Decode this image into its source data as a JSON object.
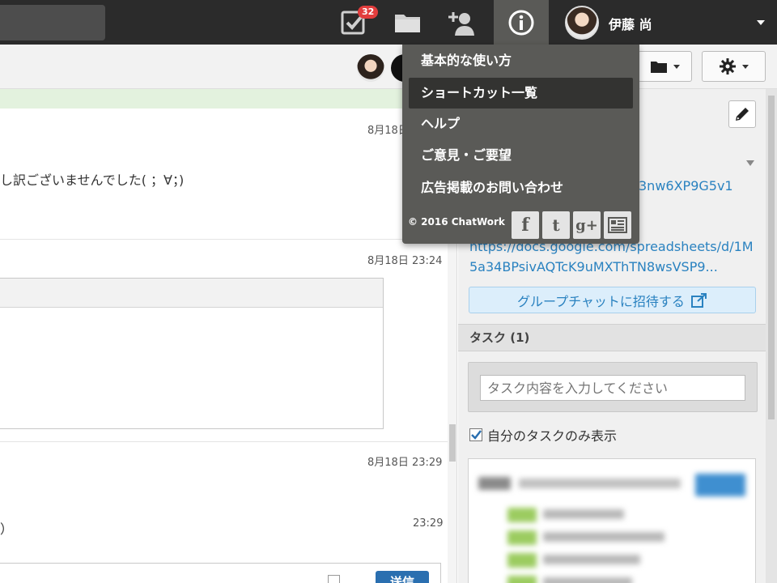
{
  "topbar": {
    "task_badge": "32",
    "user_name": "伊藤 尚"
  },
  "icons": {
    "tasks": "task-check-icon",
    "files": "folder-icon",
    "contacts": "add-contact-icon",
    "info": "info-icon",
    "settings": "gear-icon",
    "edit": "pencil-icon",
    "external": "external-link-icon"
  },
  "colors": {
    "topbar": "#2b2b2b",
    "dropdown": "#5a5a57",
    "badge": "#e23d3d",
    "link": "#2a82c0",
    "send": "#2a6fb0"
  },
  "help_menu": {
    "items": [
      {
        "label": "基本的な使い方"
      },
      {
        "label": "ショートカット一覧"
      },
      {
        "label": "ヘルプ"
      },
      {
        "label": "ご意見・ご要望"
      },
      {
        "label": "広告掲載のお問い合わせ"
      }
    ],
    "copyright": "© 2016 ChatWork",
    "social": [
      "facebook-icon",
      "twitter-icon",
      "google-plus-icon",
      "blog-icon"
    ],
    "social_glyphs": [
      "f",
      "t",
      "g+",
      ""
    ]
  },
  "chat": {
    "messages": [
      {
        "time": "8月18日",
        "text": "し訳ございませんでした( ；∀；)"
      },
      {
        "time": "8月18日 23:24",
        "text": ""
      },
      {
        "time": "8月18日 23:29",
        "text": "）"
      },
      {
        "time": "23:29",
        "text": ""
      }
    ],
    "send_label": "送信"
  },
  "room_info": {
    "link1_tail": "3nw6XP9G5v1",
    "link2_line1": "https://docs.google.com/spreadsheets/d/1M",
    "link2_line2": "5a34BPsivAQTcK9uMXThTN8wsVSP9...",
    "invite_label": "グループチャットに招待する"
  },
  "tasks": {
    "header": "タスク (1)",
    "input_placeholder": "タスク内容を入力してください",
    "only_mine_label": "自分のタスクのみ表示",
    "only_mine_checked": true
  }
}
